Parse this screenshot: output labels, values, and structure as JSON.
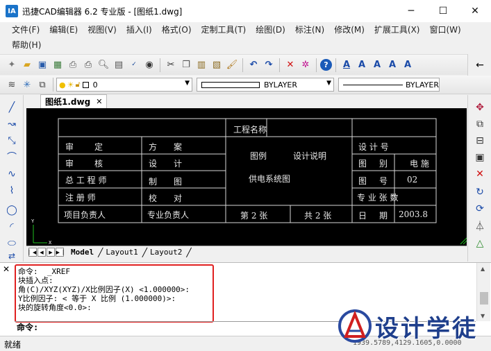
{
  "window": {
    "title": "迅捷CAD编辑器 6.2 专业版 - [图纸1.dwg]",
    "app_icon_text": "IA",
    "minimize": "─",
    "maximize": "☐",
    "close": "✕"
  },
  "menu": [
    "文件(F)",
    "编辑(E)",
    "视图(V)",
    "插入(I)",
    "格式(O)",
    "定制工具(T)",
    "绘图(D)",
    "标注(N)",
    "修改(M)",
    "扩展工具(X)",
    "窗口(W)",
    "帮助(H)"
  ],
  "toolbar2": {
    "layer_value": "0",
    "linetype_value": "BYLAYER",
    "lineweight_value": "BYLAYER"
  },
  "document": {
    "tab_label": "图纸1.dwg",
    "tab_close": "✕"
  },
  "layout_tabs": [
    "Model",
    "Layout1",
    "Layout2"
  ],
  "title_block": {
    "r1c3": "工程名称",
    "r2c1a": "审",
    "r2c1b": "定",
    "r2c2a": "方",
    "r2c2b": "案",
    "r2c3a": "图例",
    "r2c3b": "设计说明",
    "r2c4a": "设 计 号",
    "r3c1a": "审",
    "r3c1b": "核",
    "r3c2a": "设",
    "r3c2b": "计",
    "r3c4a": "图",
    "r3c4b": "别",
    "r3c4c": "电 施",
    "r4c1": "总 工 程 师",
    "r4c2a": "制",
    "r4c2b": "图",
    "r4c3": "供电系统图",
    "r4c4a": "图",
    "r4c4b": "号",
    "r4c4c": "02",
    "r5c1": "注 册 师",
    "r5c2a": "校",
    "r5c2b": "对",
    "r5c4a": "专 业 张 数",
    "r6c1": "项目负责人",
    "r6c2": "专业负责人",
    "r6c3a": "第 2 张",
    "r6c3b": "共 2 张",
    "r6c4a": "日",
    "r6c4b": "期",
    "r6c4c": "2003.8"
  },
  "command": {
    "history": [
      "命令:  _XREF",
      "块插入点:",
      "角(C)/XYZ(XYZ)/X比例因子(X) <1.000000>:",
      "Y比例因子: < 等于 X 比例 (1.000000)>:",
      "块的旋转角度<0.0>:"
    ],
    "prompt": "命令:"
  },
  "status": {
    "text": "就绪",
    "coords": "1939.5789,4129.1605,0.0000"
  },
  "watermark": "设计学徒"
}
